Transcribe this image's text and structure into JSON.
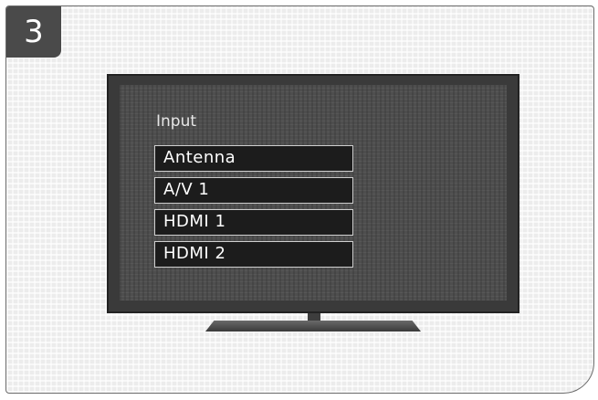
{
  "step": {
    "number": "3"
  },
  "tv": {
    "menu_title": "Input",
    "inputs": [
      {
        "label": "Antenna"
      },
      {
        "label": "A/V 1"
      },
      {
        "label": "HDMI 1"
      },
      {
        "label": "HDMI 2"
      }
    ]
  },
  "colors": {
    "badge": "#4a4a4a",
    "bezel": "#3a3a3a",
    "screen": "#4e4e4e",
    "item_bg": "#1c1c1c",
    "item_border": "#cfcfcf",
    "text": "#ffffff"
  }
}
